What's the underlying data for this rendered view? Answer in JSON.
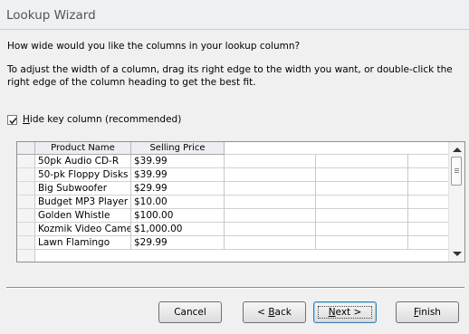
{
  "window": {
    "title": "Lookup Wizard"
  },
  "prompt": "How wide would you like the columns in your lookup column?",
  "description": "To adjust the width of a column, drag its right edge to the width you want, or double-click the right edge of the column heading to get the best fit.",
  "hide_key": {
    "checked": true,
    "accel": "H",
    "label_rest": "ide key column (recommended)"
  },
  "grid": {
    "headers": [
      "Product Name",
      "Selling Price"
    ],
    "rows": [
      [
        "50pk Audio CD-R",
        "$39.99"
      ],
      [
        "50-pk Floppy Disks",
        "$39.99"
      ],
      [
        "Big Subwoofer",
        "$29.99"
      ],
      [
        "Budget MP3 Player",
        "$10.00"
      ],
      [
        "Golden Whistle",
        "$100.00"
      ],
      [
        "Kozmik Video Came",
        "$1,000.00"
      ],
      [
        "Lawn Flamingo",
        "$29.99"
      ]
    ]
  },
  "buttons": {
    "cancel": "Cancel",
    "back": {
      "pre": "< ",
      "accel": "B",
      "rest": "ack"
    },
    "next": {
      "accel": "N",
      "rest": "ext >"
    },
    "finish": {
      "accel": "F",
      "rest": "inish"
    }
  }
}
